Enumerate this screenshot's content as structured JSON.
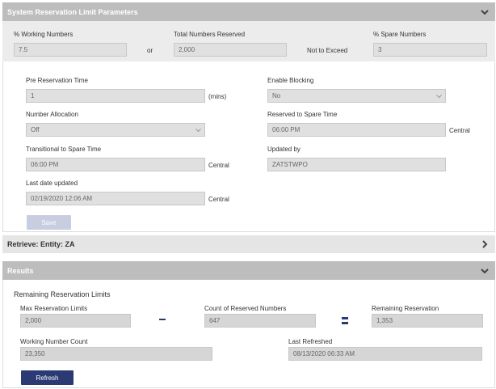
{
  "section1": {
    "title": "System Reservation Limit Parameters",
    "working_numbers_label": "% Working Numbers",
    "working_numbers_value": "7.5",
    "or_text": "or",
    "total_reserved_label": "Total Numbers Reserved",
    "total_reserved_value": "2,000",
    "not_exceed_text": "Not to Exceed",
    "spare_numbers_label": "% Spare Numbers",
    "spare_numbers_value": "3",
    "pre_reservation_label": "Pre Reservation Time",
    "pre_reservation_value": "1",
    "mins_text": "(mins)",
    "enable_blocking_label": "Enable Blocking",
    "enable_blocking_value": "No",
    "number_allocation_label": "Number Allocation",
    "number_allocation_value": "Off",
    "reserved_to_spare_label": "Reserved to Spare Time",
    "reserved_to_spare_value": "06:00 PM",
    "reserved_to_spare_tz": "Central",
    "transitional_label": "Transitional to Spare Time",
    "transitional_value": "06:00 PM",
    "transitional_tz": "Central",
    "updated_by_label": "Updated by",
    "updated_by_value": "ZATSTWPO",
    "last_date_label": "Last date updated",
    "last_date_value": "02/19/2020 12:06 AM",
    "last_date_tz": "Central",
    "save_label": "Save"
  },
  "section2": {
    "title": "Retrieve: Entity: ZA"
  },
  "section3": {
    "title": "Results",
    "subtitle": "Remaining Reservation Limits",
    "max_limits_label": "Max Reservation Limits",
    "max_limits_value": "2,000",
    "count_reserved_label": "Count of Reserved Numbers",
    "count_reserved_value": "647",
    "remaining_label": "Remaining Reservation",
    "remaining_value": "1,353",
    "working_count_label": "Working Number Count",
    "working_count_value": "23,350",
    "last_refreshed_label": "Last Refreshed",
    "last_refreshed_value": "08/13/2020 06:33 AM",
    "refresh_label": "Refresh"
  },
  "icons": {
    "collapse": "chevron-down-icon",
    "expand": "chevron-right-icon",
    "select_caret": "caret-down-icon"
  },
  "colors": {
    "header_bg": "#bdbdbd",
    "primary_button": "#2b3a73",
    "disabled_button": "#c8cde0"
  }
}
